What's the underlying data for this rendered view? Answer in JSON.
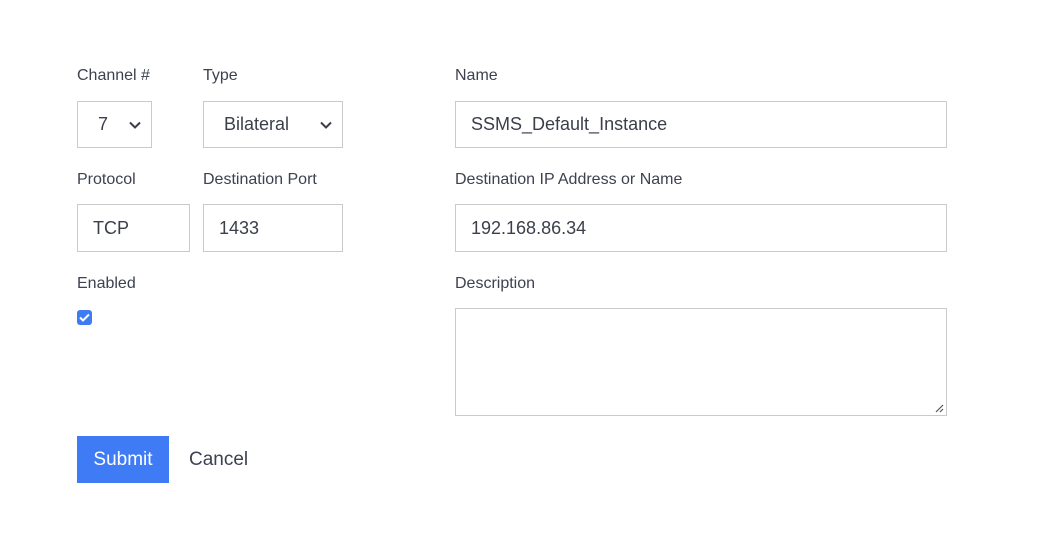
{
  "form": {
    "channel": {
      "label": "Channel #",
      "value": "7"
    },
    "type": {
      "label": "Type",
      "value": "Bilateral"
    },
    "name": {
      "label": "Name",
      "value": "SSMS_Default_Instance"
    },
    "protocol": {
      "label": "Protocol",
      "value": "TCP"
    },
    "destination_port": {
      "label": "Destination Port",
      "value": "1433"
    },
    "destination_ip": {
      "label": "Destination IP Address or Name",
      "value": "192.168.86.34"
    },
    "enabled": {
      "label": "Enabled",
      "checked": true
    },
    "description": {
      "label": "Description",
      "value": ""
    }
  },
  "actions": {
    "submit_label": "Submit",
    "cancel_label": "Cancel"
  },
  "colors": {
    "accent": "#3f7bf5",
    "border": "#c8cacd",
    "text": "#3b3f4a"
  }
}
